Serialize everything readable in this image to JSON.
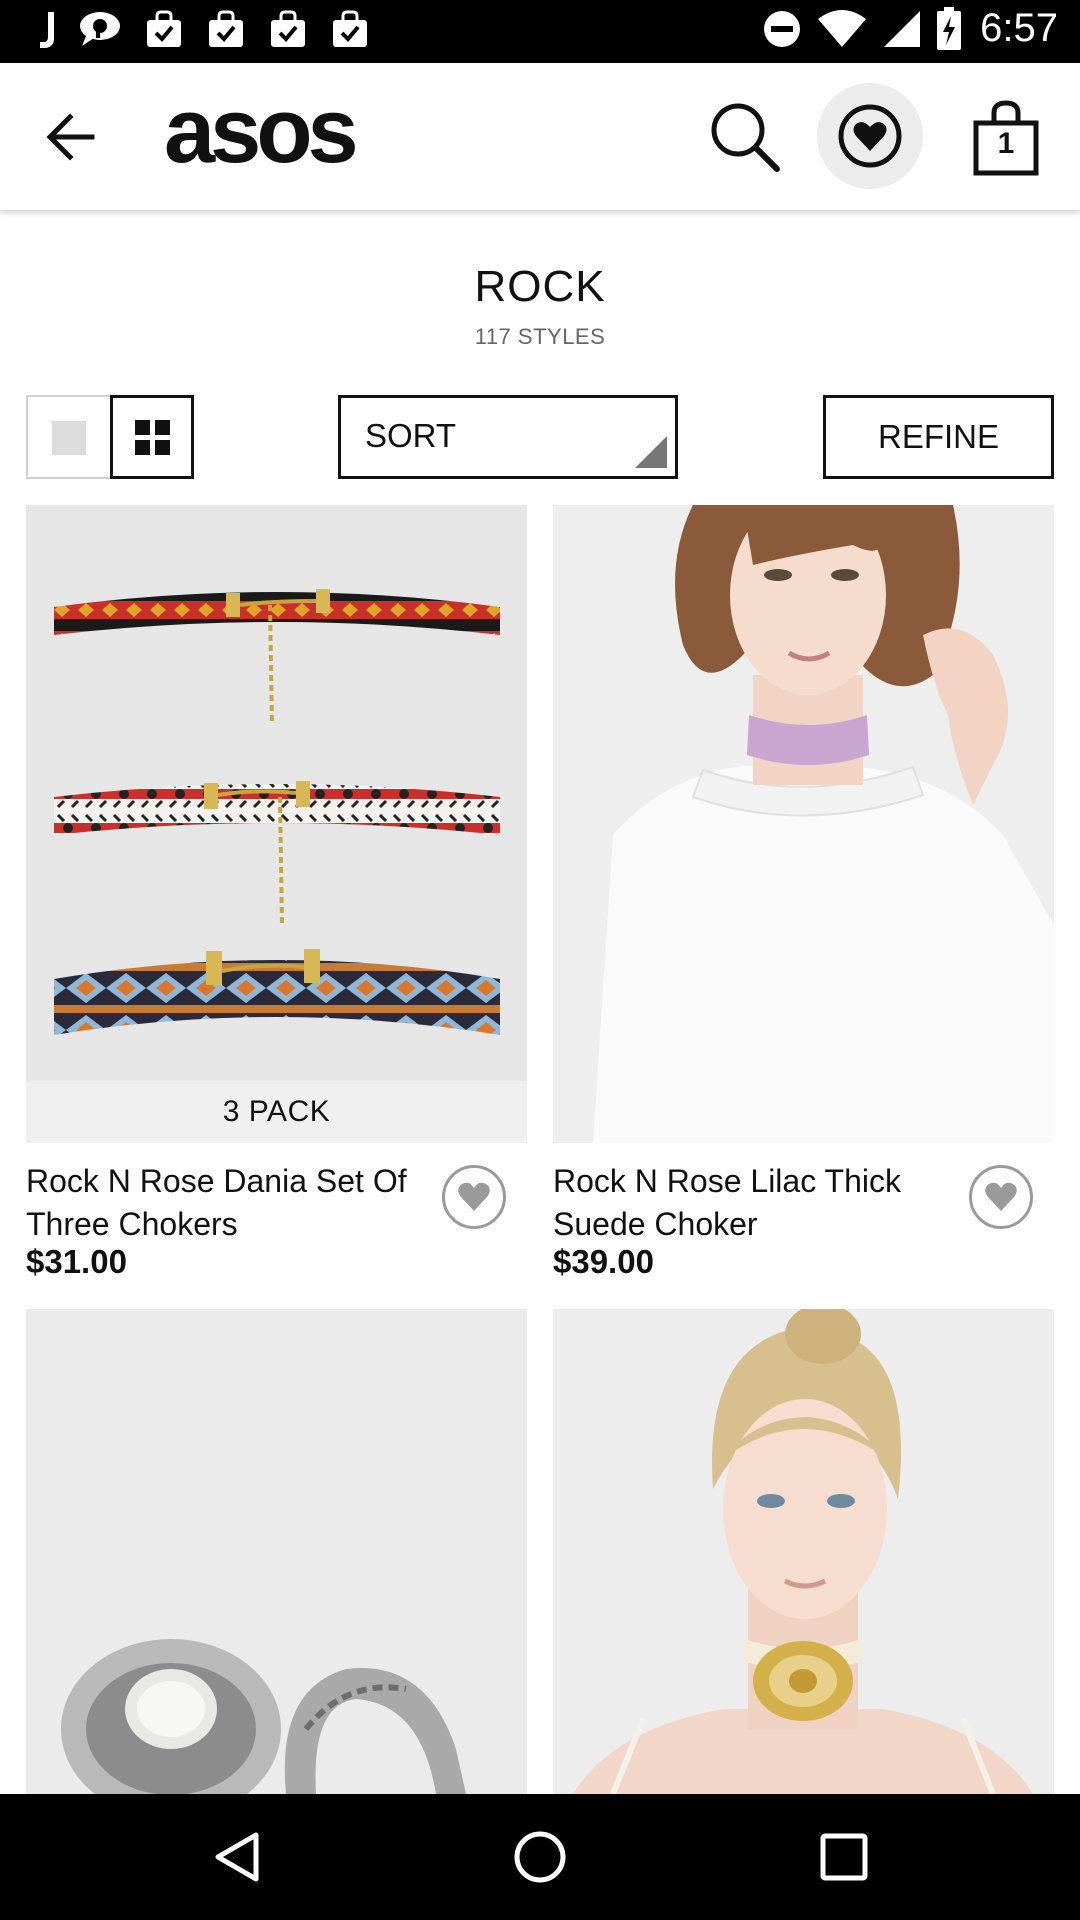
{
  "status_bar": {
    "time": "6:57",
    "icons": [
      "j-app-icon",
      "chat-icon",
      "bag-notification-icon",
      "bag-notification-icon",
      "bag-notification-icon",
      "bag-notification-icon",
      "do-not-disturb-icon",
      "wifi-icon",
      "cell-signal-icon",
      "battery-charging-icon"
    ]
  },
  "header": {
    "brand": "asos",
    "bag_count": "1",
    "icons": [
      "back-arrow-icon",
      "search-icon",
      "heart-icon",
      "shopping-bag-icon"
    ]
  },
  "category": {
    "title": "ROCK",
    "count": "117 STYLES"
  },
  "toolbar": {
    "sort_label": "SORT",
    "refine_label": "REFINE",
    "view_mode": "grid"
  },
  "products": [
    {
      "name": "Rock N Rose Dania Set Of Three Chokers",
      "price": "$31.00",
      "badge": "3 PACK",
      "image": "three-patterned-chokers"
    },
    {
      "name": "Rock N Rose Lilac Thick Suede Choker",
      "price": "$39.00",
      "image": "model-lilac-choker"
    },
    {
      "image": "silver-rings"
    },
    {
      "image": "model-gold-medallion-choker"
    }
  ],
  "nav_bar": {
    "icons": [
      "back-triangle-icon",
      "home-circle-icon",
      "recents-square-icon"
    ]
  }
}
